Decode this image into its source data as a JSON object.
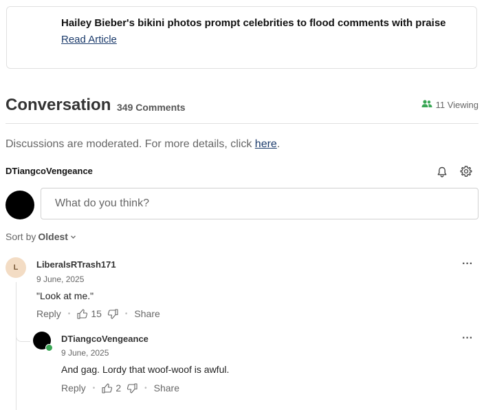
{
  "article": {
    "title": "Hailey Bieber's bikini photos prompt celebrities to flood comments with praise",
    "link_label": "Read Article"
  },
  "conversation": {
    "title": "Conversation",
    "count_label": "349 Comments",
    "viewing_label": "11 Viewing"
  },
  "moderation": {
    "text": "Discussions are moderated. For more details, click ",
    "link_label": "here",
    "suffix": "."
  },
  "current_user": {
    "username": "DTiangcoVengeance"
  },
  "input": {
    "placeholder": "What do you think?"
  },
  "sort": {
    "prefix": "Sort by",
    "value": "Oldest"
  },
  "comments": [
    {
      "avatar_letter": "L",
      "username": "LiberalsRTrash171",
      "date": "9 June, 2025",
      "text": "\"Look at me.\"",
      "reply_label": "Reply",
      "likes": "15",
      "share_label": "Share"
    },
    {
      "username": "DTiangcoVengeance",
      "date": "9 June, 2025",
      "text": "And gag. Lordy that woof-woof is awful.",
      "reply_label": "Reply",
      "likes": "2",
      "share_label": "Share"
    }
  ],
  "icons": {
    "viewing": "people-icon",
    "bell": "bell-icon",
    "settings": "gear-icon",
    "like": "thumbs-up-icon",
    "dislike": "thumbs-down-icon",
    "more": "more-options-icon",
    "sort": "chevron-down-icon"
  },
  "colors": {
    "link": "#1a3a6b",
    "online": "#3aa655",
    "viewing_icon": "#3aa655",
    "avatar_l_bg": "#f3dcc4"
  }
}
